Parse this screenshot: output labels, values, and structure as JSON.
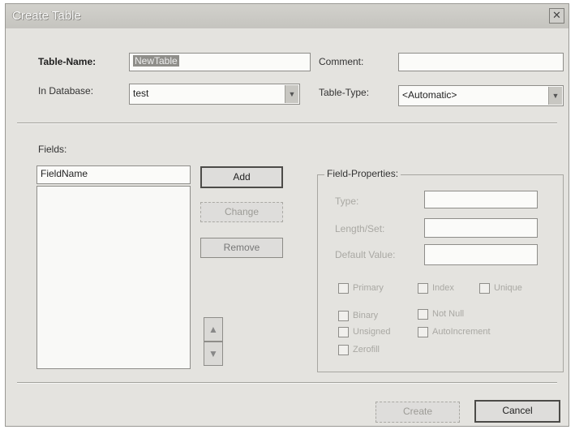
{
  "dialog": {
    "title": "Create Table",
    "close_icon": "close-icon"
  },
  "header": {
    "table_name_label": "Table-Name:",
    "table_name_value": "NewTable",
    "comment_label": "Comment:",
    "comment_value": "",
    "in_database_label": "In Database:",
    "in_database_value": "test",
    "table_type_label": "Table-Type:",
    "table_type_value": "<Automatic>"
  },
  "fields": {
    "label": "Fields:",
    "field_name_value": "FieldName",
    "items": []
  },
  "buttons": {
    "add": "Add",
    "change": "Change",
    "remove": "Remove",
    "move_up_icon": "arrow-up-icon",
    "move_down_icon": "arrow-down-icon",
    "create": "Create",
    "cancel": "Cancel"
  },
  "field_properties": {
    "title": "Field-Properties:",
    "type_label": "Type:",
    "length_label": "Length/Set:",
    "default_value_label": "Default Value:",
    "type_value": "",
    "length_value": "",
    "default_value": "",
    "checkboxes": {
      "primary": "Primary",
      "index": "Index",
      "unique": "Unique",
      "binary": "Binary",
      "not_null": "Not Null",
      "unsigned": "Unsigned",
      "auto_increment": "AutoIncrement",
      "zerofill": "Zerofill"
    }
  }
}
